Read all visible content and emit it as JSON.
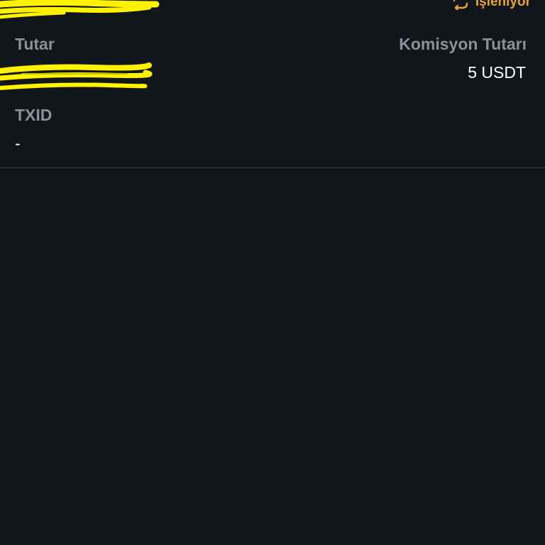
{
  "status": {
    "label": "İşleniyor",
    "icon": "sync-icon",
    "color": "#e8a23a"
  },
  "details": {
    "amount_label": "Tutar",
    "fee_label": "Komisyon Tutarı",
    "fee_value": "5 USDT",
    "txid_label": "TXID",
    "txid_value": "-"
  },
  "colors": {
    "background": "#11161b",
    "label": "#8a919b",
    "value": "#ffffff",
    "redaction": "#fff200"
  }
}
